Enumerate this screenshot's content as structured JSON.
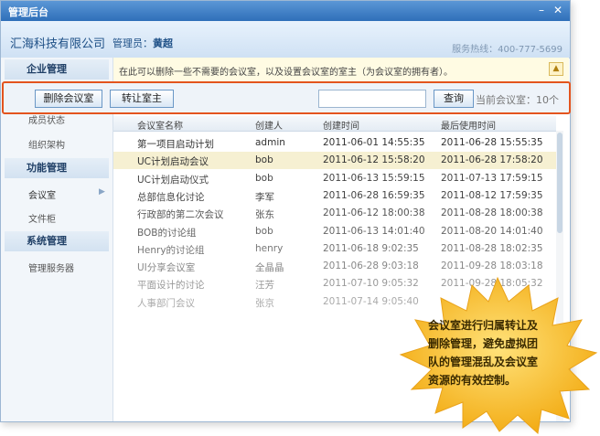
{
  "window": {
    "title": "管理后台"
  },
  "header": {
    "company": "汇海科技有限公司",
    "admin_label": "管理员：",
    "admin_name": "黄超",
    "hotline": "服务热线：400-777-5699"
  },
  "sidebar": {
    "sections": [
      {
        "title": "企业管理",
        "items": [
          "成员状态",
          "组织架构"
        ]
      },
      {
        "title": "功能管理",
        "items": [
          "会议室",
          "文件柜"
        ]
      },
      {
        "title": "系统管理",
        "items": [
          "管理服务器"
        ]
      }
    ]
  },
  "notice": {
    "text": "在此可以删除一些不需要的会议室，以及设置会议室的室主（为会议室的拥有者）。"
  },
  "toolbar": {
    "delete_label": "删除会议室",
    "transfer_label": "转让室主",
    "search_label": "查询",
    "search_value": "",
    "count_text": "当前会议室：10个"
  },
  "table": {
    "columns": [
      "会议室名称",
      "创建人",
      "创建时间",
      "最后使用时间"
    ],
    "rows": [
      [
        "第一项目启动计划",
        "admin",
        "2011-06-01 14:55:35",
        "2011-06-28 15:55:35"
      ],
      [
        "UC计划启动会议",
        "bob",
        "2011-06-12 15:58:20",
        "2011-06-28 17:58:20"
      ],
      [
        "UC计划启动仪式",
        "bob",
        "2011-06-13 15:59:15",
        "2011-07-13 17:59:15"
      ],
      [
        "总部信息化讨论",
        "李军",
        "2011-06-28 16:59:35",
        "2011-08-12 17:59:35"
      ],
      [
        "行政部的第二次会议",
        "张东",
        "2011-06-12 18:00:38",
        "2011-08-28 18:00:38"
      ],
      [
        "BOB的讨论组",
        "bob",
        "2011-06-13 14:01:40",
        "2011-08-20 14:01:40"
      ],
      [
        "Henry的讨论组",
        "henry",
        "2011-06-18 9:02:35",
        "2011-08-28 18:02:35"
      ],
      [
        "UI分享会议室",
        "全晶晶",
        "2011-06-28 9:03:18",
        "2011-09-28 18:03:18"
      ],
      [
        "平面设计的讨论",
        "汪芳",
        "2011-07-10 9:05:32",
        "2011-09-28 18:05:32"
      ],
      [
        "人事部门会议",
        "张京",
        "2011-07-14 9:05:40",
        ""
      ]
    ]
  },
  "callout": {
    "lines": [
      "会议室进行归属转让及",
      "删除管理，避免虚拟团",
      "队的管理混乱及会议室",
      "资源的有效控制。"
    ]
  },
  "colors": {
    "accent": "#3a7cc4",
    "highlight_border": "#e3541e",
    "callout_fill": "#f7b81a"
  }
}
